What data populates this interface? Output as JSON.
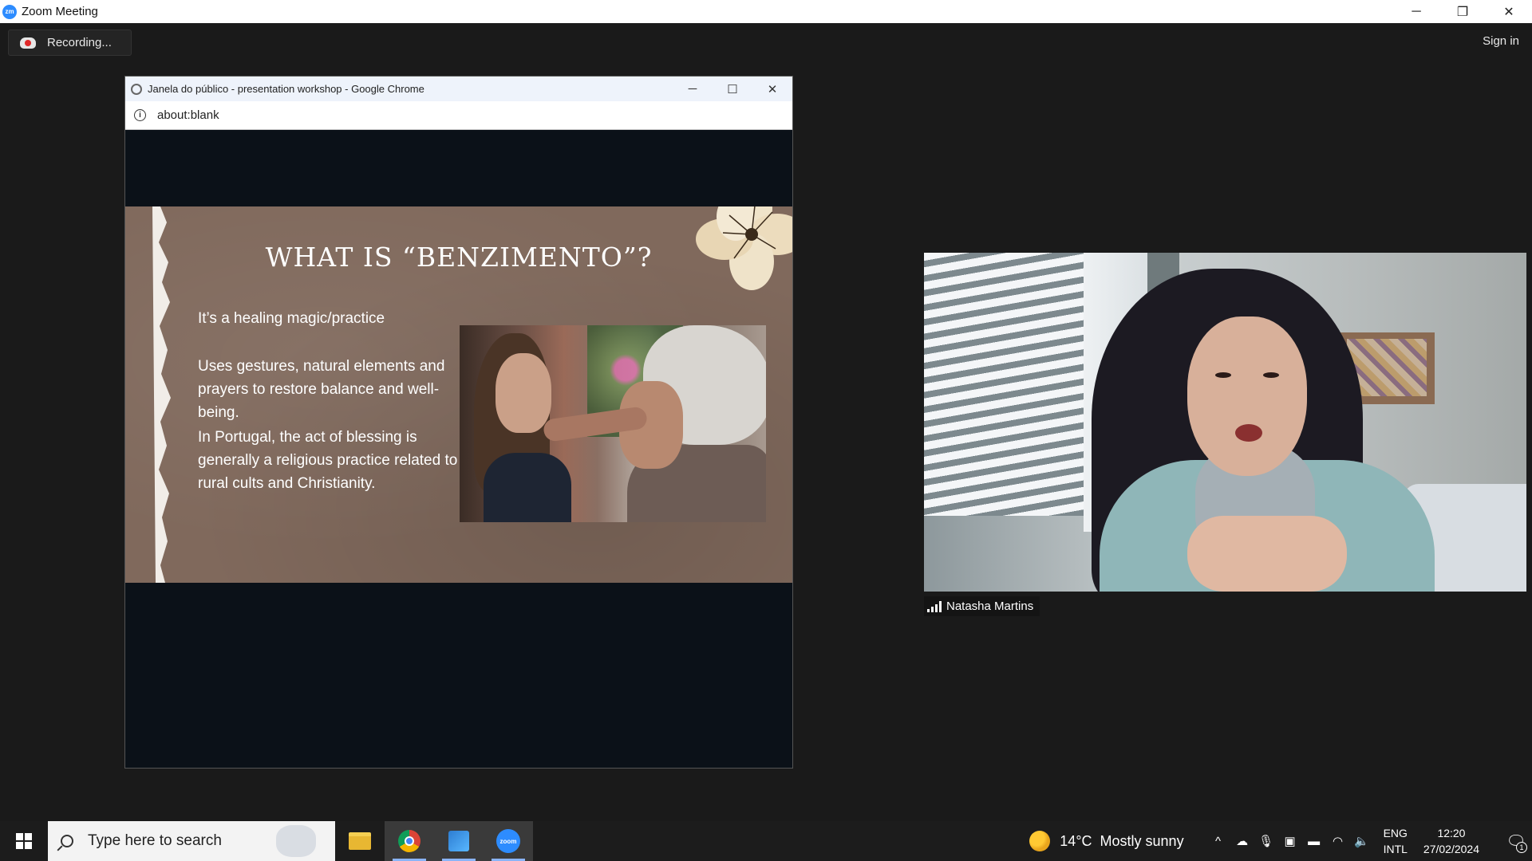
{
  "app": {
    "title": "Zoom Meeting",
    "logo_text": "zm"
  },
  "window_controls": {
    "minimize": "─",
    "restore": "❐",
    "close": "✕"
  },
  "meeting": {
    "recording_label": "Recording...",
    "sign_in_label": "Sign in"
  },
  "chrome_window": {
    "title": "Janela do público - presentation workshop - Google Chrome",
    "url": "about:blank",
    "info_symbol": "i",
    "controls": {
      "minimize": "─",
      "maximize": "☐",
      "close": "✕"
    }
  },
  "slide": {
    "title": "WHAT IS “BENZIMENTO”?",
    "paragraph_1": "It’s a healing magic/practice",
    "paragraph_2": "Uses gestures, natural elements and prayers to restore balance and well-being.",
    "paragraph_3": "In Portugal, the act of blessing is generally a religious practice related to rural cults and Christianity."
  },
  "participant": {
    "name": "Natasha Martins"
  },
  "taskbar": {
    "search_placeholder": "Type here to search",
    "apps": [
      {
        "name": "File Explorer",
        "icon": "folder-icon"
      },
      {
        "name": "Google Chrome",
        "icon": "chrome-icon"
      },
      {
        "name": "Photos",
        "icon": "photos-icon"
      },
      {
        "name": "Zoom",
        "icon": "zoom-icon",
        "logo_text": "zoom"
      }
    ],
    "weather": {
      "temperature": "14°C",
      "condition": "Mostly sunny"
    },
    "tray_icons": [
      "chevron-up-icon",
      "onedrive-icon",
      "microphone-icon",
      "display-icon",
      "battery-icon",
      "wifi-icon",
      "speaker-icon"
    ],
    "language": {
      "line1": "ENG",
      "line2": "INTL"
    },
    "clock": {
      "time": "12:20",
      "date": "27/02/2024"
    },
    "notification_count": "1"
  }
}
